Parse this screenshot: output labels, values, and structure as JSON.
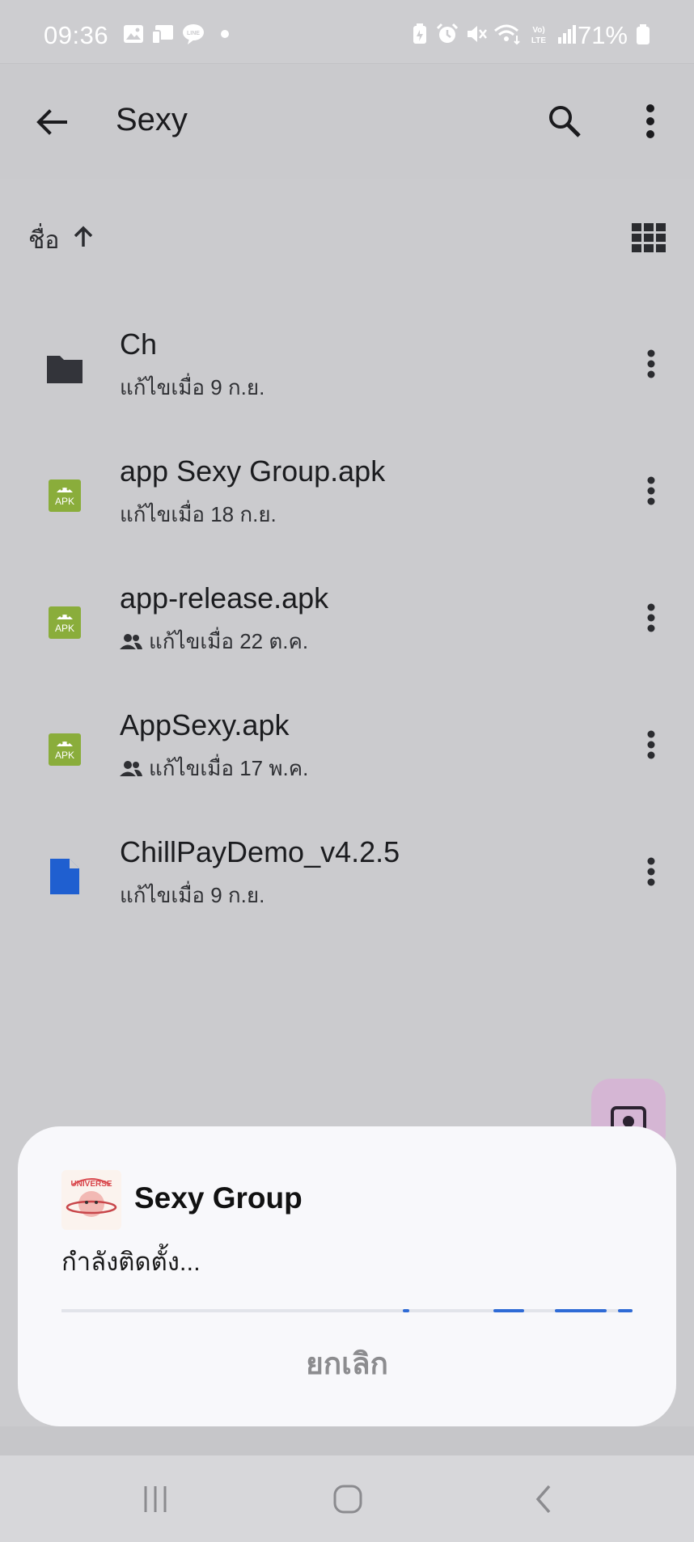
{
  "status_bar": {
    "time": "09:36",
    "battery": "71%",
    "icons": [
      "gallery-icon",
      "cast-icon",
      "line-icon",
      "dot-icon",
      "battery-saver-icon",
      "alarm-icon",
      "mute-icon",
      "wifi-icon",
      "volte-icon",
      "signal-icon",
      "battery-icon"
    ]
  },
  "app_bar": {
    "title": "Sexy",
    "back_icon": "back-arrow-icon",
    "search_icon": "search-icon",
    "more_icon": "more-vert-icon"
  },
  "toolbar": {
    "sort_label": "ชื่อ",
    "sort_icon": "arrow-up-icon",
    "view_icon": "grid-view-icon"
  },
  "files": [
    {
      "name": "Ch",
      "meta": "แก้ไขเมื่อ 9 ก.ย.",
      "type": "folder",
      "shared": false
    },
    {
      "name": "app Sexy Group.apk",
      "meta": "แก้ไขเมื่อ 18 ก.ย.",
      "type": "apk",
      "shared": false
    },
    {
      "name": "app-release.apk",
      "meta": "แก้ไขเมื่อ 22 ต.ค.",
      "type": "apk",
      "shared": true
    },
    {
      "name": "AppSexy.apk",
      "meta": "แก้ไขเมื่อ 17 พ.ค.",
      "type": "apk",
      "shared": true
    },
    {
      "name": "ChillPayDemo_v4.2.5",
      "meta": "แก้ไขเมื่อ 9 ก.ย.",
      "type": "doc",
      "shared": false
    }
  ],
  "apk_badge": "APK",
  "dialog": {
    "app_name": "Sexy Group",
    "logo_text": "UNIVERSE",
    "status": "กำลังติดตั้ง...",
    "cancel_label": "ยกเลิก"
  },
  "colors": {
    "apk_green": "#8aad3b",
    "doc_blue": "#1f5fd0",
    "folder_dark": "#33343a",
    "progress_blue": "#2f6bd6"
  }
}
